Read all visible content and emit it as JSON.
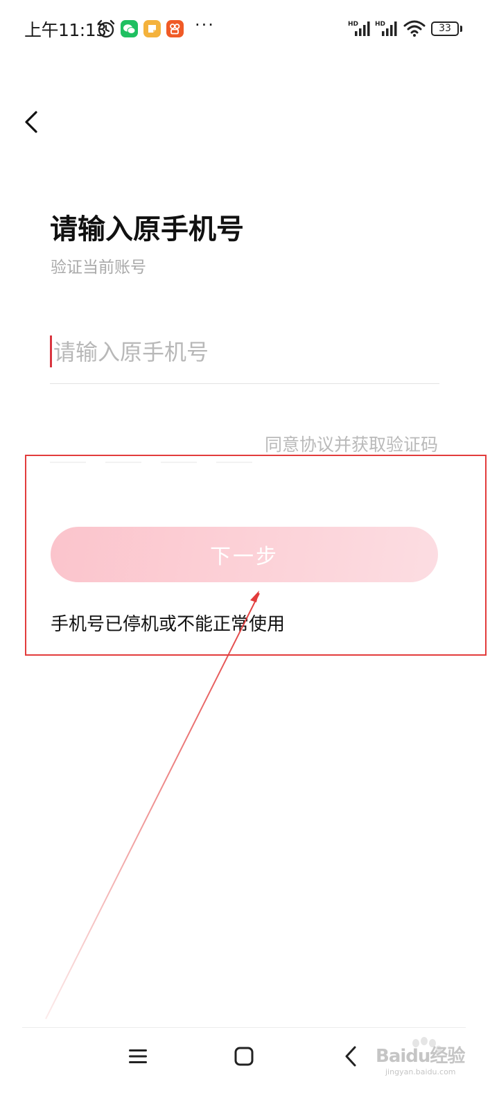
{
  "status_bar": {
    "time": "上午11:13",
    "battery": "33",
    "signal_label": "HD",
    "more": "···"
  },
  "page": {
    "title": "请输入原手机号",
    "subtitle": "验证当前账号"
  },
  "phone_input": {
    "placeholder": "请输入原手机号",
    "value": ""
  },
  "verification": {
    "get_code_label": "同意协议并获取验证码"
  },
  "actions": {
    "next_label": "下一步",
    "unavailable_label": "手机号已停机或不能正常使用"
  },
  "colors": {
    "accent": "#d9353f",
    "button_disabled": "#fcd0d6",
    "annotation": "#e23b3b"
  },
  "watermark": {
    "text": "Baidu经验",
    "sub": "jingyan.baidu.com"
  }
}
